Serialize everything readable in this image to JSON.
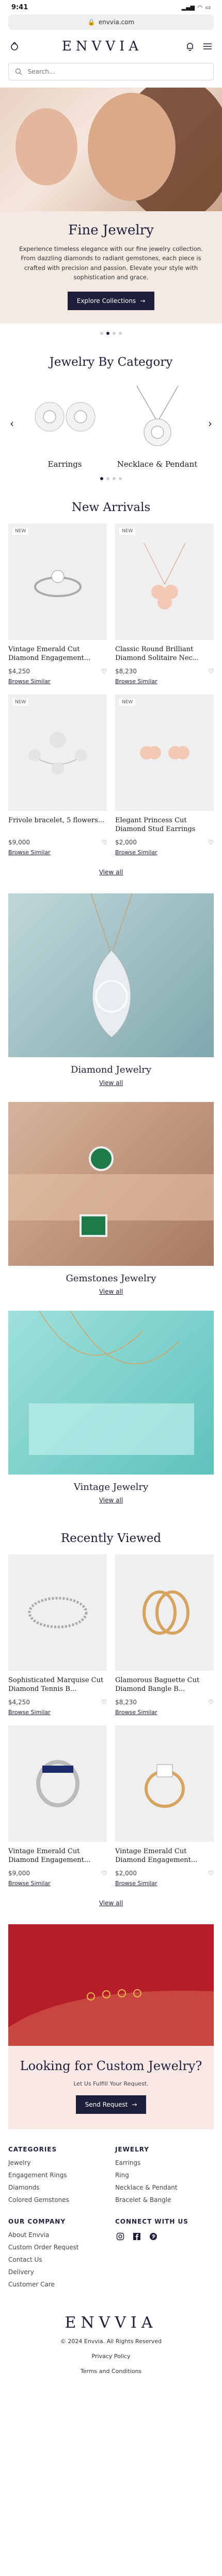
{
  "status": {
    "time": "9:41"
  },
  "browser": {
    "url": "envvia.com"
  },
  "header": {
    "logo": "ENVVIA"
  },
  "search": {
    "placeholder": "Search..."
  },
  "hero": {
    "title": "Fine Jewelry",
    "text": "Experience timeless elegance with our fine jewelry collection. From dazzling diamonds to radiant gemstones, each piece is crafted with precision and passion. Elevate your style with sophistication and grace.",
    "button": "Explore Collections"
  },
  "category": {
    "title": "Jewelry By Category",
    "items": [
      {
        "label": "Earrings"
      },
      {
        "label": "Necklace & Pendant"
      }
    ]
  },
  "new_arrivals": {
    "title": "New Arrivals",
    "badge": "NEW",
    "products": [
      {
        "name": "Vintage Emerald Cut Diamond Engagement...",
        "price": "$4,250",
        "link": "Browse Similar"
      },
      {
        "name": "Classic Round Brilliant Diamond Solitaire Nec...",
        "price": "$8,230",
        "link": "Browse Similar"
      },
      {
        "name": "Frivole bracelet, 5 flowers...",
        "price": "$9,000",
        "link": "Browse Similar"
      },
      {
        "name": "Elegant Princess Cut Diamond Stud Earrings",
        "price": "$2,000",
        "link": "Browse Similar"
      }
    ],
    "view_all": "View all"
  },
  "banners": [
    {
      "title": "Diamond Jewelry",
      "link": "View all"
    },
    {
      "title": "Gemstones Jewelry",
      "link": "View all"
    },
    {
      "title": "Vintage Jewelry",
      "link": "View all"
    }
  ],
  "recently_viewed": {
    "title": "Recently Viewed",
    "products": [
      {
        "name": "Sophisticated Marquise Cut Diamond Tennis B...",
        "price": "$4,250",
        "link": "Browse Similar"
      },
      {
        "name": "Glamorous Baguette Cut Diamond Bangle B...",
        "price": "$8,230",
        "link": "Browse Similar"
      },
      {
        "name": "Vintage Emerald Cut Diamond Engagement...",
        "price": "$9,000",
        "link": "Browse Similar"
      },
      {
        "name": "Vintage Emerald Cut Diamond Engagement...",
        "price": "$2,000",
        "link": "Browse Similar"
      }
    ],
    "view_all": "View all"
  },
  "custom": {
    "title": "Looking for Custom Jewelry?",
    "subtitle": "Let Us Fulfill Your Request.",
    "button": "Send Request"
  },
  "footer": {
    "categories_title": "CATEGORIES",
    "categories": [
      "Jewelry",
      "Engagement Rings",
      "Diamonds",
      "Colored Gemstones"
    ],
    "jewelry_title": "JEWELRY",
    "jewelry": [
      "Earrings",
      "Ring",
      "Necklace & Pendant",
      "Bracelet & Bangle"
    ],
    "company_title": "OUR COMPANY",
    "company": [
      "About Envvia",
      "Custom Order Request",
      "Contact Us",
      "Delivery",
      "Customer Care"
    ],
    "connect_title": "CONNECT WITH US",
    "logo": "ENVVIA",
    "copyright": "© 2024 Envvia. All Rights Reserved",
    "privacy": "Privacy Policy",
    "terms": "Terms and Conditions"
  },
  "colors": {
    "navy": "#1d1f3a",
    "blush": "#f5e9e3",
    "red": "#b71c2a"
  }
}
